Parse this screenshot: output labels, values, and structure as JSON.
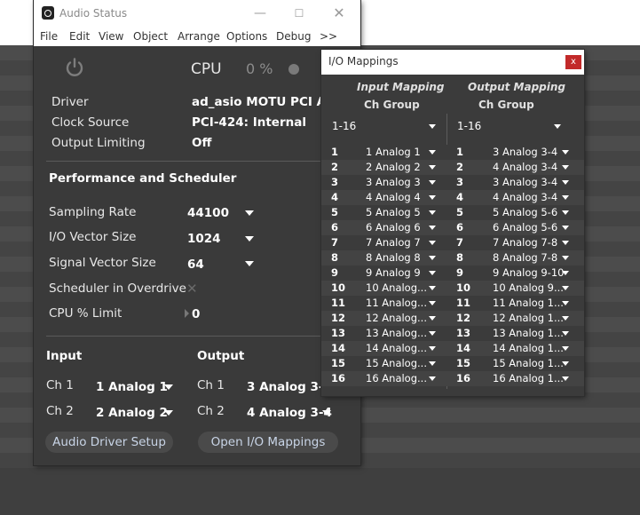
{
  "audio_status": {
    "title": "Audio Status",
    "menu": [
      "File",
      "Edit",
      "View",
      "Object",
      "Arrange",
      "Options",
      "Debug",
      ">>"
    ],
    "cpu_label": "CPU",
    "cpu_value": "0 %",
    "driver_label": "Driver",
    "driver_value": "ad_asio MOTU PCI A...",
    "clock_label": "Clock Source",
    "clock_value": "PCI-424: Internal",
    "output_limiting_label": "Output Limiting",
    "output_limiting_value": "Off",
    "perf_heading": "Performance and Scheduler",
    "sampling_rate_label": "Sampling Rate",
    "sampling_rate_value": "44100",
    "io_vector_label": "I/O Vector Size",
    "io_vector_value": "1024",
    "signal_vector_label": "Signal Vector Size",
    "signal_vector_value": "64",
    "overdrive_label": "Scheduler in Overdrive",
    "cpu_limit_label": "CPU % Limit",
    "cpu_limit_value": "0",
    "input_heading": "Input",
    "output_heading": "Output",
    "in_ch1_label": "Ch 1",
    "in_ch1_value": "1 Analog 1",
    "in_ch2_label": "Ch 2",
    "in_ch2_value": "2 Analog 2",
    "out_ch1_label": "Ch 1",
    "out_ch1_value": "3 Analog 3-4",
    "out_ch2_label": "Ch 2",
    "out_ch2_value": "4 Analog 3-4",
    "driver_setup_button": "Audio Driver Setup",
    "open_io_button": "Open I/O Mappings"
  },
  "io_mappings": {
    "title": "I/O Mappings",
    "close": "x",
    "input_heading": "Input Mapping",
    "output_heading": "Output Mapping",
    "ch_group_label": "Ch Group",
    "input_group": "1-16",
    "output_group": "1-16",
    "rows": [
      {
        "n": "1",
        "in": "1 Analog 1",
        "out": "3 Analog 3-4"
      },
      {
        "n": "2",
        "in": "2 Analog 2",
        "out": "4 Analog 3-4"
      },
      {
        "n": "3",
        "in": "3 Analog 3",
        "out": "3 Analog 3-4"
      },
      {
        "n": "4",
        "in": "4 Analog 4",
        "out": "4 Analog 3-4"
      },
      {
        "n": "5",
        "in": "5 Analog 5",
        "out": "5 Analog 5-6"
      },
      {
        "n": "6",
        "in": "6 Analog 6",
        "out": "6 Analog 5-6"
      },
      {
        "n": "7",
        "in": "7 Analog 7",
        "out": "7 Analog 7-8"
      },
      {
        "n": "8",
        "in": "8 Analog 8",
        "out": "8 Analog 7-8"
      },
      {
        "n": "9",
        "in": "9 Analog 9",
        "out": "9 Analog 9-10"
      },
      {
        "n": "10",
        "in": "10 Analog...",
        "out": "10 Analog 9..."
      },
      {
        "n": "11",
        "in": "11 Analog...",
        "out": "11 Analog 1..."
      },
      {
        "n": "12",
        "in": "12 Analog...",
        "out": "12 Analog 1..."
      },
      {
        "n": "13",
        "in": "13 Analog...",
        "out": "13 Analog 1..."
      },
      {
        "n": "14",
        "in": "14 Analog...",
        "out": "14 Analog 1..."
      },
      {
        "n": "15",
        "in": "15 Analog...",
        "out": "15 Analog 1..."
      },
      {
        "n": "16",
        "in": "16 Analog...",
        "out": "16 Analog 1..."
      }
    ]
  }
}
